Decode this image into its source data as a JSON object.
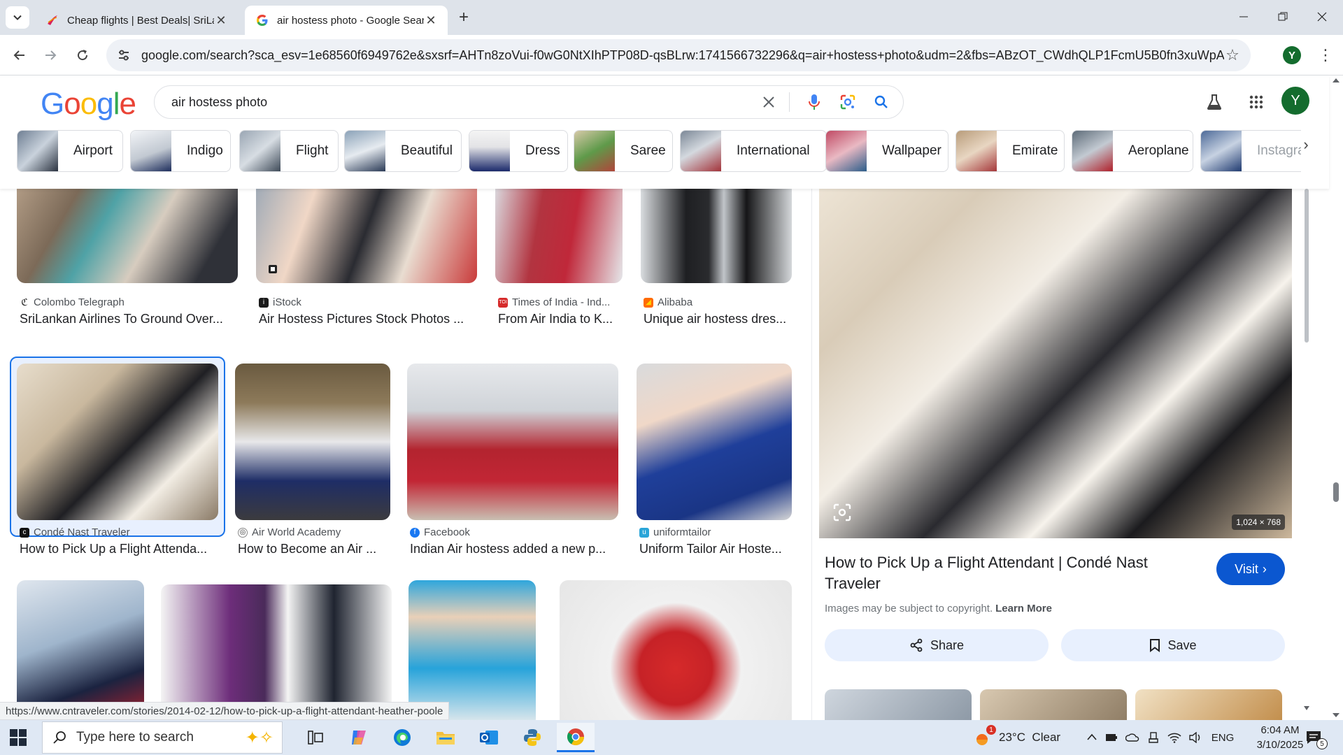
{
  "browser": {
    "tabs": [
      {
        "title": "Cheap flights | Best Deals| SriLa",
        "active": false
      },
      {
        "title": "air hostess photo - Google Sear",
        "active": true
      }
    ],
    "url": "google.com/search?sca_esv=1e68560f6949762e&sxsrf=AHTn8zoVui-f0wG0NtXIhPTP08D-qsBLrw:1741566732296&q=air+hostess+photo&udm=2&fbs=ABzOT_CWdhQLP1FcmU5B0fn3xuWpA-dk4wpB...",
    "profile_initial": "Y"
  },
  "google": {
    "query": "air hostess photo",
    "avatar_initial": "Y",
    "chips": [
      "Airport",
      "Indigo",
      "Flight",
      "Beautiful",
      "Dress",
      "Saree",
      "International",
      "Wallpaper",
      "Emirate",
      "Aeroplane",
      "Instagram"
    ]
  },
  "results": [
    {
      "source": "Colombo Telegraph",
      "title": "SriLankan Airlines To Ground Over..."
    },
    {
      "source": "iStock",
      "title": "Air Hostess Pictures Stock Photos ..."
    },
    {
      "source": "Times of India - Ind...",
      "title": "From Air India to K..."
    },
    {
      "source": "Alibaba",
      "title": "Unique air hostess dres..."
    },
    {
      "source": "Condé Nast Traveler",
      "title": "How to Pick Up a Flight Attenda..."
    },
    {
      "source": "Air World Academy",
      "title": "How to Become an Air ..."
    },
    {
      "source": "Facebook",
      "title": "Indian Air hostess added a new p..."
    },
    {
      "source": "uniformtailor",
      "title": "Uniform Tailor Air Hoste..."
    }
  ],
  "panel": {
    "dimensions": "1,024 × 768",
    "title": "How to Pick Up a Flight Attendant | Condé Nast Traveler",
    "visit_label": "Visit",
    "copyright": "Images may be subject to copyright.",
    "learn_more": "Learn More",
    "share_label": "Share",
    "save_label": "Save"
  },
  "status_url": "https://www.cntraveler.com/stories/2014-02-12/how-to-pick-up-a-flight-attendant-heather-poole",
  "taskbar": {
    "search_placeholder": "Type here to search",
    "weather": "23°C  Clear",
    "weather_badge": "1",
    "language": "ENG",
    "time": "6:04 AM",
    "date": "3/10/2025",
    "notifications": "5"
  },
  "colors": {
    "accent": "#1a73e8",
    "visit": "#0b57d0",
    "taskbar": "#dfe8f4",
    "tabstrip": "#dee3ea"
  }
}
